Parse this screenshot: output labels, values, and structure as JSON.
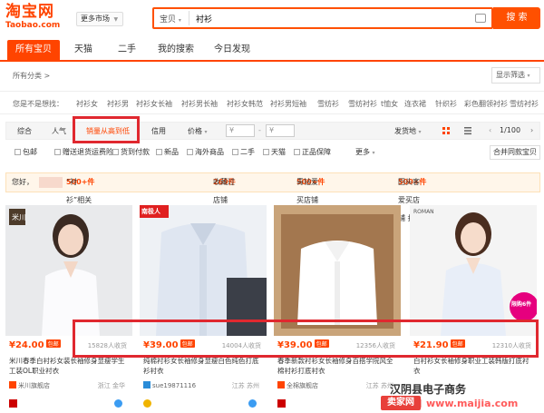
{
  "header": {
    "logo_cn": "淘宝网",
    "logo_en": "Taobao.com",
    "market_label": "更多市场",
    "search_category": "宝贝",
    "search_query": "衬衫",
    "search_button": "搜 索"
  },
  "tabs": [
    {
      "label": "所有宝贝",
      "active": true
    },
    {
      "label": "天猫"
    },
    {
      "label": "二手"
    },
    {
      "label": "我的搜索"
    },
    {
      "label": "今日发现"
    }
  ],
  "breadcrumb": "所有分类 >",
  "display_option": "显示筛选",
  "guess": {
    "label": "您是不是想找：",
    "terms": [
      "衬衫女",
      "衬衫男",
      "衬衫女长袖",
      "衬衫男长袖",
      "衬衫女韩范",
      "衬衫男短袖",
      "雪纺衫",
      "雪纺衬衫",
      "t恤女",
      "连衣裙",
      "针织衫",
      "彩色翻领衬衫",
      "雪纺衬衫"
    ]
  },
  "sort": {
    "options": [
      "综合",
      "人气",
      "销量从高到低",
      "信用",
      "价格"
    ],
    "price_from": "¥",
    "price_to": "¥",
    "ship_from": "发货地",
    "page": "1/100"
  },
  "filters": [
    "包邮",
    "赠送退货运费险",
    "货到付款",
    "新品",
    "海外商品",
    "二手",
    "天猫",
    "正品保障"
  ],
  "filters_more": "更多",
  "filters_merge": "合并同款宝贝",
  "notice": {
    "prefix": "您好，",
    "seg1": "“衬衫”相关的全店：购买过店铺 找到",
    "seg1_count": "500+件",
    "seg2": "收藏过店铺 找到",
    "seg2_count": "269件",
    "seg3": "青钻爱买店铺 找到",
    "seg3_count": "500+件",
    "seg4": "回头客爱买店铺 找到",
    "seg4_count": "500+件"
  },
  "products": [
    {
      "price": "¥24.00",
      "badge": "包邮",
      "sold": "15828人收货",
      "title": "米川春季白衬衫女装长袖修身显瘦学生工装OL职业衬衣",
      "shop": "米川旗舰店",
      "location": "浙江 金华"
    },
    {
      "price": "¥39.00",
      "badge": "包邮",
      "sold": "14004人收货",
      "title": "纯棉衬衫女长袖修身显瘦白色纯色打底衫衬衣",
      "shop": "sue19871116",
      "location": "江苏 苏州"
    },
    {
      "price": "¥39.00",
      "badge": "包邮",
      "sold": "12356人收货",
      "title": "春季新款衬衫女长袖修身百搭学院风全棉衬衫打底衬衣",
      "shop": "全棉旗舰店",
      "location": "江苏 苏州"
    },
    {
      "price": "¥21.90",
      "badge": "包邮",
      "sold": "12310人收货",
      "title": "白衬衫女长袖修身职业工装韩版打底衬衣",
      "shop": "",
      "location": ""
    }
  ],
  "product_tags": {
    "brand": "米川",
    "shop2_logo": "南极人",
    "shop4_logo": "ROMAN",
    "promo": "限购6件"
  },
  "watermark": {
    "line1": "汉阴县电子商务",
    "logo": "卖家网",
    "url": "www.maijia.com"
  }
}
